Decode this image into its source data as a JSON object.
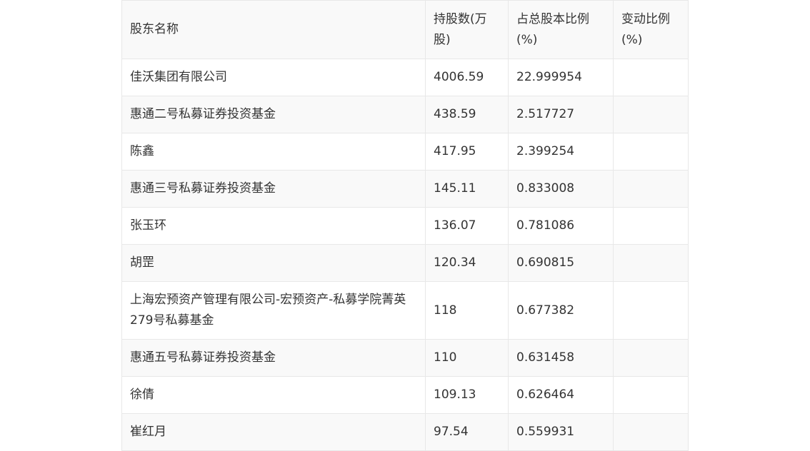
{
  "table": {
    "headers": [
      "股东名称",
      "持股数(万股)",
      "占总股本比例(%)",
      "变动比例(%)"
    ],
    "rows": [
      [
        "佳沃集团有限公司",
        "4006.59",
        "22.999954",
        ""
      ],
      [
        "惠通二号私募证券投资基金",
        "438.59",
        "2.517727",
        ""
      ],
      [
        "陈鑫",
        "417.95",
        "2.399254",
        ""
      ],
      [
        "惠通三号私募证券投资基金",
        "145.11",
        "0.833008",
        ""
      ],
      [
        "张玉环",
        "136.07",
        "0.781086",
        ""
      ],
      [
        "胡罡",
        "120.34",
        "0.690815",
        ""
      ],
      [
        "上海宏预资产管理有限公司-宏预资产-私募学院菁英279号私募基金",
        "118",
        "0.677382",
        ""
      ],
      [
        "惠通五号私募证券投资基金",
        "110",
        "0.631458",
        ""
      ],
      [
        "徐倩",
        "109.13",
        "0.626464",
        ""
      ],
      [
        "崔红月",
        "97.54",
        "0.559931",
        ""
      ]
    ]
  }
}
